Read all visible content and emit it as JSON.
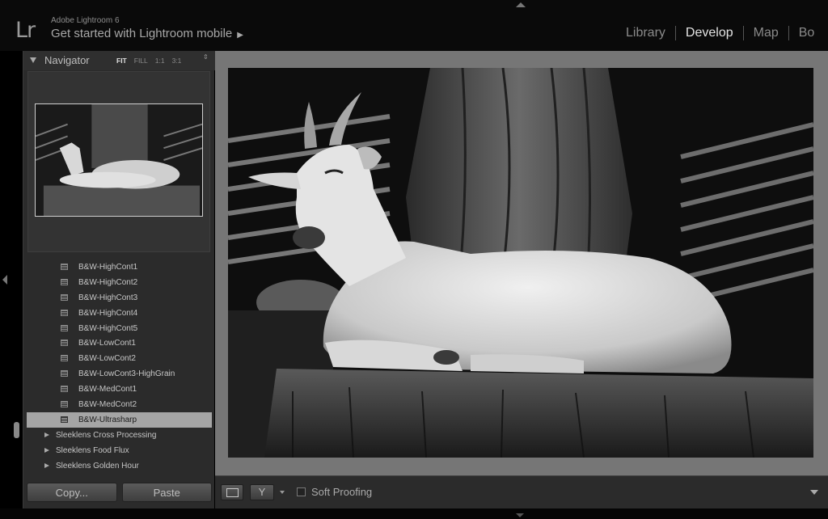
{
  "app": {
    "logo": "Lr",
    "name": "Adobe Lightroom 6",
    "mobile_link": "Get started with Lightroom mobile",
    "mobile_arrow": "▶"
  },
  "modules": [
    {
      "label": "Library",
      "active": false
    },
    {
      "label": "Develop",
      "active": true
    },
    {
      "label": "Map",
      "active": false
    },
    {
      "label": "Bo",
      "active": false
    }
  ],
  "navigator": {
    "title": "Navigator",
    "zoom_options": [
      "FIT",
      "FILL",
      "1:1",
      "3:1"
    ],
    "zoom_active": "FIT",
    "zoom_spinner": "⇕"
  },
  "presets": {
    "children": [
      "B&W-HighCont1",
      "B&W-HighCont2",
      "B&W-HighCont3",
      "B&W-HighCont4",
      "B&W-HighCont5",
      "B&W-LowCont1",
      "B&W-LowCont2",
      "B&W-LowCont3-HighGrain",
      "B&W-MedCont1",
      "B&W-MedCont2",
      "B&W-Ultrasharp"
    ],
    "selected": "B&W-Ultrasharp",
    "folders": [
      "Sleeklens Cross Processing",
      "Sleeklens Food Flux",
      "Sleeklens Golden Hour"
    ]
  },
  "buttons": {
    "copy": "Copy...",
    "paste": "Paste"
  },
  "toolbar": {
    "soft_proofing": "Soft Proofing",
    "compare_glyph": "Y"
  },
  "icons": {
    "preset_icon": "preset-document-icon",
    "folder_icon": "disclosure-triangle-icon",
    "loupe_icon": "loupe-view-icon",
    "compare_icon": "before-after-icon"
  }
}
